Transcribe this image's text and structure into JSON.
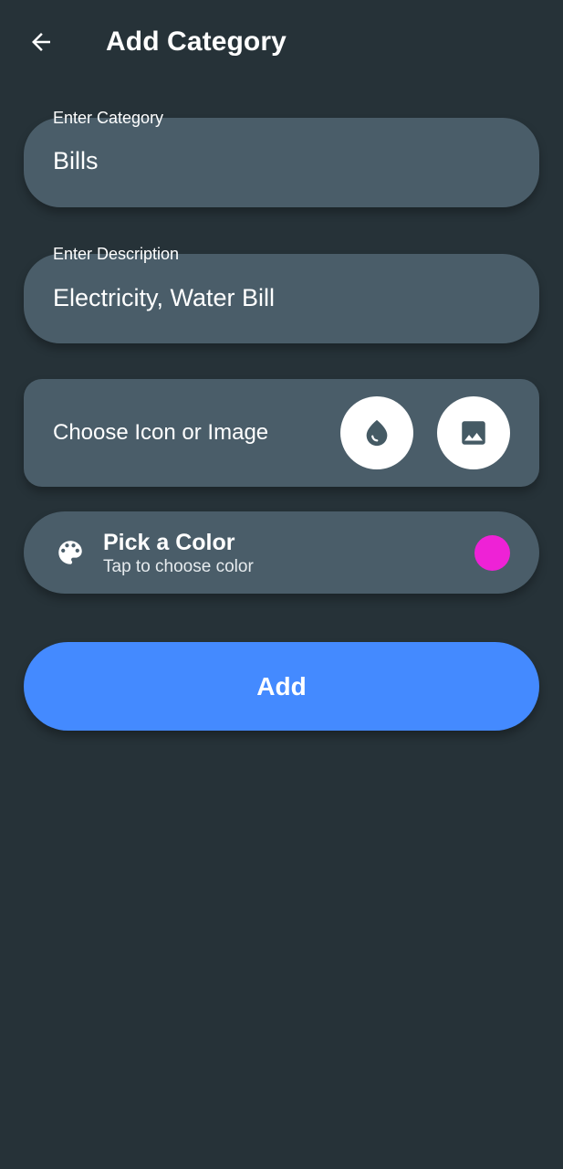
{
  "app_bar": {
    "title": "Add Category",
    "back_icon": "arrow-back-icon"
  },
  "category_field": {
    "label": "Enter Category",
    "value": "Bills"
  },
  "description_field": {
    "label": "Enter Description",
    "value": "Electricity, Water Bill"
  },
  "icon_picker": {
    "label": "Choose Icon or Image",
    "icon_button_icon": "water-drop-icon",
    "image_button_icon": "image-icon"
  },
  "color_picker": {
    "title": "Pick a Color",
    "subtitle": "Tap to choose color",
    "icon": "palette-icon",
    "selected_color": "#ee22d6"
  },
  "submit": {
    "label": "Add"
  },
  "theme": {
    "background": "#263238",
    "surface": "#4a5d69",
    "accent": "#448aff"
  }
}
